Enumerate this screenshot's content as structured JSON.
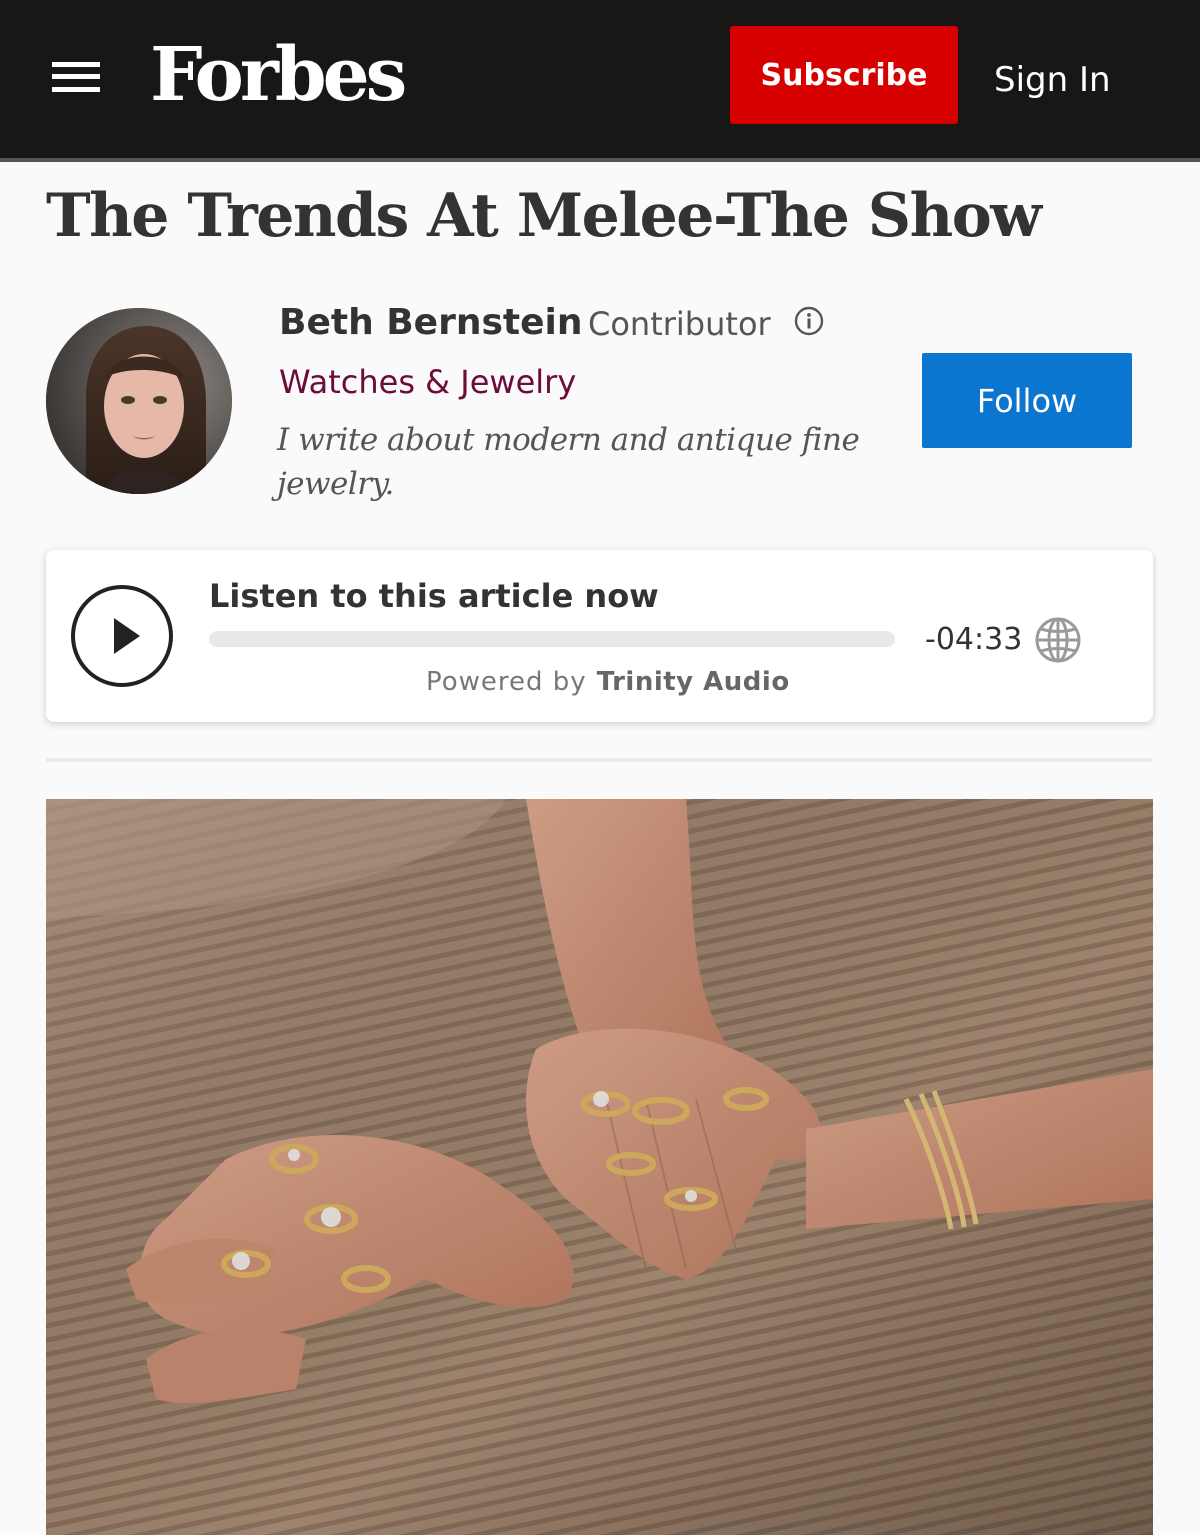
{
  "header": {
    "menu_icon": "hamburger-menu-icon",
    "logo_text": "Forbes",
    "subscribe_label": "Subscribe",
    "signin_label": "Sign In",
    "colors": {
      "background": "#181716",
      "subscribe": "#d70000"
    }
  },
  "article": {
    "headline": "The Trends At Melee-The Show"
  },
  "author": {
    "name": "Beth Bernstein",
    "role": "Contributor",
    "info_icon": "info-circle-icon",
    "channel": "Watches & Jewelry",
    "bio": "I write about modern and antique fine jewelry.",
    "follow_label": "Follow",
    "colors": {
      "channel": "#6b0c3a",
      "follow": "#0a76d0"
    }
  },
  "audio": {
    "play_icon": "play-icon",
    "title": "Listen to this article now",
    "progress_fraction": 0,
    "time_remaining": "-04:33",
    "language_icon": "globe-icon",
    "powered_by_label": "Powered by",
    "powered_by_brand": "Trinity Audio"
  },
  "hero_image": {
    "icon": "photo"
  }
}
